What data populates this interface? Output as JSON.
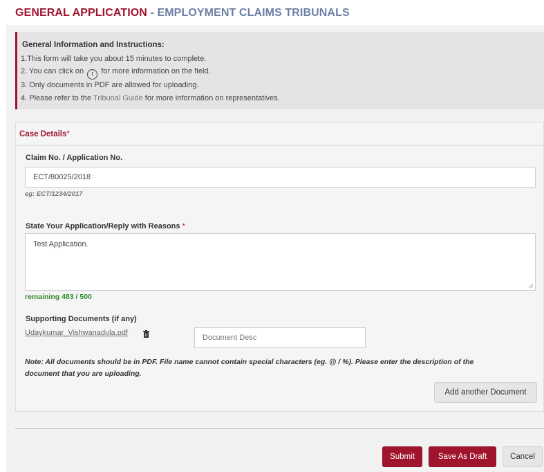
{
  "header": {
    "title_main": "GENERAL APPLICATION",
    "title_sep": " - ",
    "title_sub": "EMPLOYMENT CLAIMS TRIBUNALS"
  },
  "info": {
    "heading": "General Information and Instructions:",
    "line1": "1.This form will take you about 15 minutes to complete.",
    "line2_pre": "2. You can click on",
    "line2_icon": "i",
    "line2_post": "for more information on the field.",
    "line3": "3. Only documents in PDF are allowed for uploading.",
    "line4_pre": "4. Please refer to the",
    "line4_link": "Tribunal Guide",
    "line4_post": "for more information on representatives."
  },
  "case": {
    "title": "Case Details",
    "required_mark": "*",
    "claim_label": "Claim No. / Application No.",
    "claim_value": "ECT/80025/2018",
    "claim_hint": "eg: ECT/1234/2017",
    "reason_label": "State Your Application/Reply with Reasons",
    "reason_required": "*",
    "reason_value": "Test Application.",
    "remaining": "remaining 483 / 500",
    "docs_label": "Supporting Documents (if any)",
    "doc_file": "Udaykumar_Vishwanadula.pdf",
    "doc_desc_placeholder": "Document Desc",
    "note_line1": "Note: All documents should be in PDF. File name cannot contain special characters (eg. @ / %). Please enter the description of the",
    "note_line2": "document that you are uploading.",
    "add_doc_button": "Add another Document"
  },
  "actions": {
    "submit": "Submit",
    "save_draft": "Save As Draft",
    "cancel": "Cancel"
  },
  "colors": {
    "brand_red": "#a0142e",
    "title_blue": "#6b7fa4",
    "remaining_green": "#2e8b2e"
  }
}
